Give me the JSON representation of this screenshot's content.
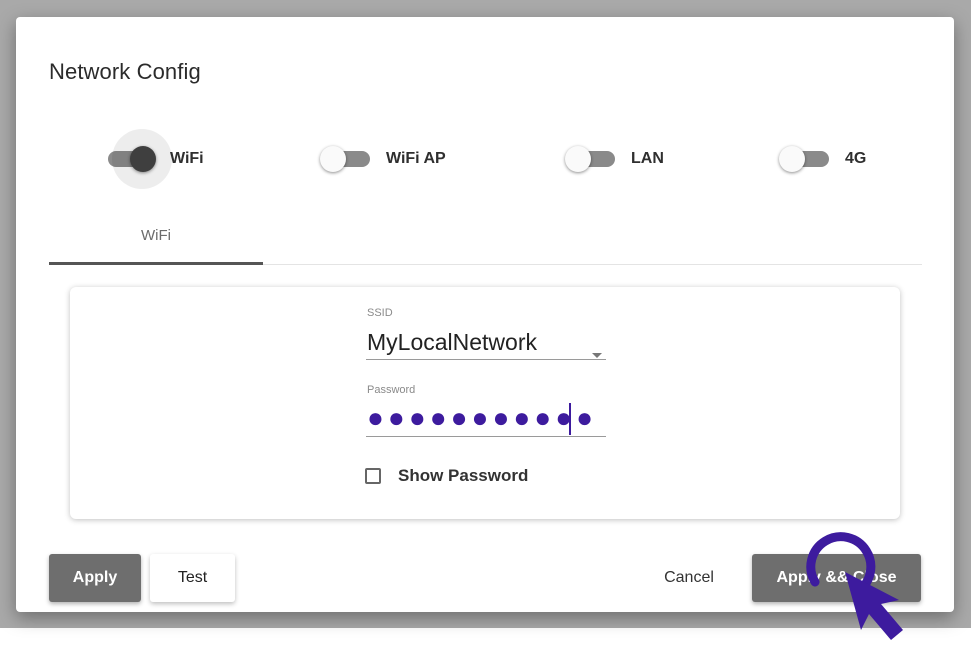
{
  "dialog": {
    "title": "Network Config"
  },
  "modes": [
    {
      "label": "WiFi",
      "state": "on"
    },
    {
      "label": "WiFi AP",
      "state": "off"
    },
    {
      "label": "LAN",
      "state": "off"
    },
    {
      "label": "4G",
      "state": "off"
    }
  ],
  "tabs": [
    {
      "label": "WiFi",
      "active": true
    }
  ],
  "form": {
    "ssid_label": "SSID",
    "ssid_value": "MyLocalNetwork",
    "password_label": "Password",
    "password_masked": "●●●●●●●●●●●",
    "show_password_label": "Show Password",
    "show_password_checked": false
  },
  "buttons": {
    "apply": "Apply",
    "test": "Test",
    "cancel": "Cancel",
    "apply_close": "Apply && Close"
  },
  "colors": {
    "accent": "#3d1b9e",
    "button_dark": "#6e6e6e"
  },
  "icons": {
    "cursor": "pointer-click-icon",
    "dropdown": "chevron-down-icon"
  }
}
